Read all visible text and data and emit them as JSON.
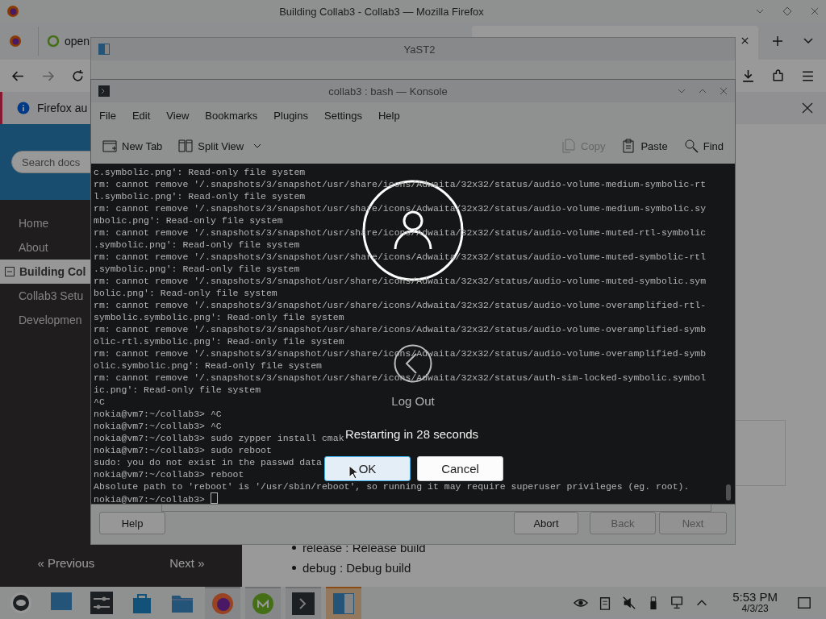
{
  "firefox": {
    "title": "Building Collab3 - Collab3 — Mozilla Firefox",
    "tabs": [
      {
        "label": "open"
      }
    ],
    "notification": "Firefox au",
    "sidebar": {
      "search_placeholder": "Search docs",
      "items": [
        {
          "label": "Home",
          "selected": false,
          "expanded": false
        },
        {
          "label": "About",
          "selected": false,
          "expanded": false
        },
        {
          "label": "Building Col",
          "selected": true,
          "expanded": true
        },
        {
          "label": "Collab3 Setu",
          "selected": false,
          "expanded": false
        },
        {
          "label": "Developmen",
          "selected": false,
          "expanded": false
        }
      ],
      "previous": "« Previous",
      "next": "Next »"
    },
    "content_bullets": [
      "release : Release build",
      "debug : Debug build"
    ]
  },
  "yast": {
    "title": "YaST2",
    "buttons": [
      {
        "label": "Help",
        "disabled": false
      },
      {
        "label": "Abort",
        "disabled": false
      },
      {
        "label": "Back",
        "disabled": true
      },
      {
        "label": "Next",
        "disabled": true
      }
    ]
  },
  "konsole": {
    "title": "collab3 : bash — Konsole",
    "menu": [
      "File",
      "Edit",
      "View",
      "Bookmarks",
      "Plugins",
      "Settings",
      "Help"
    ],
    "toolbar": [
      {
        "kind": "new-tab",
        "label": "New Tab",
        "disabled": false
      },
      {
        "kind": "split-view",
        "label": "Split View",
        "disabled": false
      },
      {
        "kind": "copy",
        "label": "Copy",
        "disabled": true
      },
      {
        "kind": "paste",
        "label": "Paste",
        "disabled": false
      },
      {
        "kind": "find",
        "label": "Find",
        "disabled": false
      }
    ],
    "lines": [
      "c.symbolic.png': Read-only file system",
      "rm: cannot remove '/.snapshots/3/snapshot/usr/share/icons/Adwaita/32x32/status/audio-volume-medium-symbolic-rt",
      "l.symbolic.png': Read-only file system",
      "rm: cannot remove '/.snapshots/3/snapshot/usr/share/icons/Adwaita/32x32/status/audio-volume-medium-symbolic.sy",
      "mbolic.png': Read-only file system",
      "rm: cannot remove '/.snapshots/3/snapshot/usr/share/icons/Adwaita/32x32/status/audio-volume-muted-rtl-symbolic",
      ".symbolic.png': Read-only file system",
      "rm: cannot remove '/.snapshots/3/snapshot/usr/share/icons/Adwaita/32x32/status/audio-volume-muted-symbolic-rtl",
      ".symbolic.png': Read-only file system",
      "rm: cannot remove '/.snapshots/3/snapshot/usr/share/icons/Adwaita/32x32/status/audio-volume-muted-symbolic.sym",
      "bolic.png': Read-only file system",
      "rm: cannot remove '/.snapshots/3/snapshot/usr/share/icons/Adwaita/32x32/status/audio-volume-overamplified-rtl-",
      "symbolic.symbolic.png': Read-only file system",
      "rm: cannot remove '/.snapshots/3/snapshot/usr/share/icons/Adwaita/32x32/status/audio-volume-overamplified-symb",
      "olic-rtl.symbolic.png': Read-only file system",
      "rm: cannot remove '/.snapshots/3/snapshot/usr/share/icons/Adwaita/32x32/status/audio-volume-overamplified-symb",
      "olic.symbolic.png': Read-only file system",
      "rm: cannot remove '/.snapshots/3/snapshot/usr/share/icons/Adwaita/32x32/status/auth-sim-locked-symbolic.symbol",
      "ic.png': Read-only file system",
      "^C",
      "nokia@vm7:~/collab3> ^C",
      "nokia@vm7:~/collab3> ^C",
      "nokia@vm7:~/collab3> sudo zypper install cmak",
      "nokia@vm7:~/collab3> sudo reboot",
      "sudo: you do not exist in the passwd data",
      "nokia@vm7:~/collab3> reboot",
      "Absolute path to 'reboot' is '/usr/sbin/reboot', so running it may require superuser privileges (eg. root).",
      "nokia@vm7:~/collab3> "
    ]
  },
  "logout": {
    "title": "Log Out",
    "message": "Restarting in 28 seconds",
    "buttons": [
      {
        "label": "OK",
        "selected": true
      },
      {
        "label": "Cancel",
        "selected": false
      }
    ]
  },
  "taskbar": {
    "time": "5:53 PM",
    "date": "4/3/23"
  }
}
